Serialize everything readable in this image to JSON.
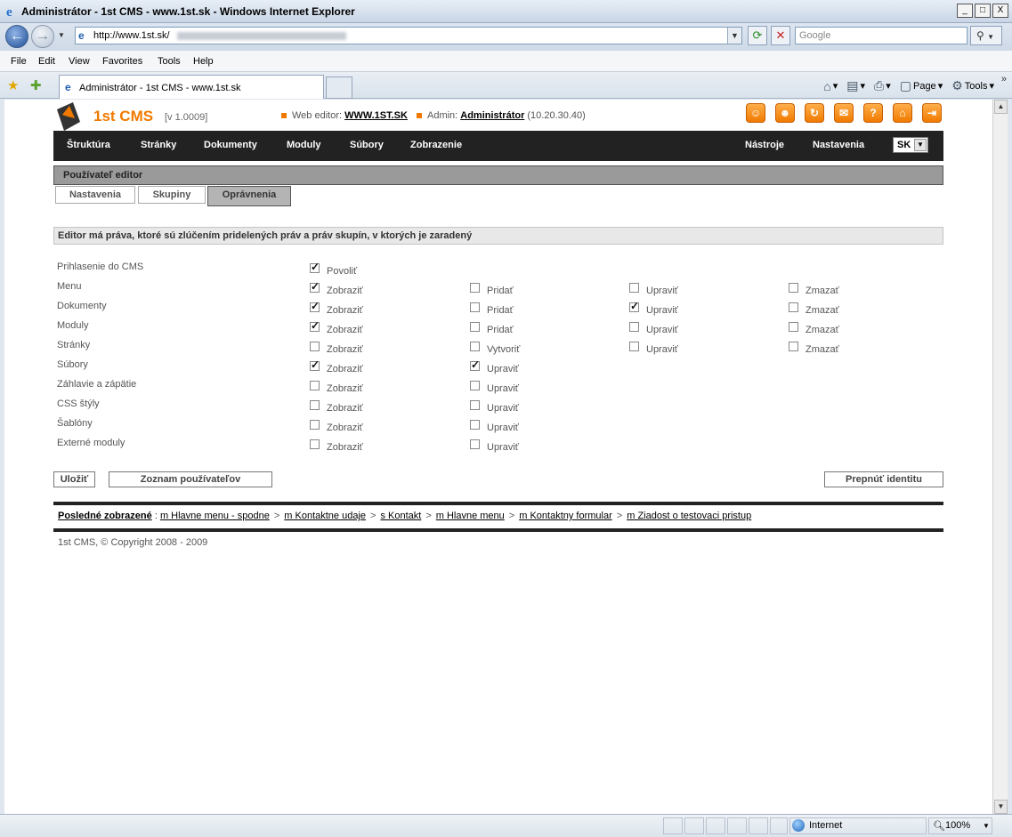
{
  "window": {
    "title": "Administrátor - 1st CMS - www.1st.sk - Windows Internet Explorer",
    "controls": [
      "_",
      "□",
      "X"
    ]
  },
  "browser": {
    "url": "http://www.1st.sk/",
    "search_placeholder": "Google",
    "menu": [
      "File",
      "Edit",
      "View",
      "Favorites",
      "Tools",
      "Help"
    ],
    "tab_title": "Administrátor - 1st CMS - www.1st.sk",
    "command_bar": {
      "page": "Page",
      "tools": "Tools"
    },
    "status": {
      "zone": "Internet",
      "zoom": "100%"
    }
  },
  "cms": {
    "name": "1st CMS",
    "version": "[v 1.0009]",
    "web_editor_label": "Web editor:",
    "web_editor_link": "WWW.1ST.SK",
    "admin_label": "Admin:",
    "admin_name": "Administrátor",
    "admin_ip": "(10.20.30.40)",
    "tool_icons": [
      "user-icon",
      "users-icon",
      "refresh-icon",
      "mail-icon",
      "help-icon",
      "home-icon",
      "logout-icon"
    ],
    "accent_color": "#f07a00"
  },
  "nav": {
    "left": [
      "Štruktúra",
      "Stránky",
      "Dokumenty",
      "Moduly",
      "Súbory",
      "Zobrazenie"
    ],
    "right": [
      "Nástroje",
      "Nastavenia"
    ],
    "language": "SK"
  },
  "section": {
    "title": "Používateľ editor",
    "tabs": [
      "Nastavenia",
      "Skupiny",
      "Oprávnenia"
    ],
    "active_tab": "Oprávnenia",
    "description": "Editor má práva, ktoré sú zlúčením pridelených práv a práv skupín, v ktorých je zaradený"
  },
  "permissions": [
    {
      "label": "Prihlasenie do CMS",
      "options": [
        {
          "label": "Povoliť",
          "checked": true
        }
      ]
    },
    {
      "label": "Menu",
      "options": [
        {
          "label": "Zobraziť",
          "checked": true
        },
        {
          "label": "Pridať",
          "checked": false
        },
        {
          "label": "Upraviť",
          "checked": false
        },
        {
          "label": "Zmazať",
          "checked": false
        }
      ]
    },
    {
      "label": "Dokumenty",
      "options": [
        {
          "label": "Zobraziť",
          "checked": true
        },
        {
          "label": "Pridať",
          "checked": false
        },
        {
          "label": "Upraviť",
          "checked": true
        },
        {
          "label": "Zmazať",
          "checked": false
        }
      ]
    },
    {
      "label": "Moduly",
      "options": [
        {
          "label": "Zobraziť",
          "checked": true
        },
        {
          "label": "Pridať",
          "checked": false
        },
        {
          "label": "Upraviť",
          "checked": false
        },
        {
          "label": "Zmazať",
          "checked": false
        }
      ]
    },
    {
      "label": "Stránky",
      "options": [
        {
          "label": "Zobraziť",
          "checked": false
        },
        {
          "label": "Vytvoriť",
          "checked": false
        },
        {
          "label": "Upraviť",
          "checked": false
        },
        {
          "label": "Zmazať",
          "checked": false
        }
      ]
    },
    {
      "label": "Súbory",
      "options": [
        {
          "label": "Zobraziť",
          "checked": true
        },
        {
          "label": "Upraviť",
          "checked": true
        }
      ]
    },
    {
      "label": "Záhlavie a zápätie",
      "options": [
        {
          "label": "Zobraziť",
          "checked": false
        },
        {
          "label": "Upraviť",
          "checked": false
        }
      ]
    },
    {
      "label": "CSS štýly",
      "options": [
        {
          "label": "Zobraziť",
          "checked": false
        },
        {
          "label": "Upraviť",
          "checked": false
        }
      ]
    },
    {
      "label": "Šablóny",
      "options": [
        {
          "label": "Zobraziť",
          "checked": false
        },
        {
          "label": "Upraviť",
          "checked": false
        }
      ]
    },
    {
      "label": "Externé moduly",
      "options": [
        {
          "label": "Zobraziť",
          "checked": false
        },
        {
          "label": "Upraviť",
          "checked": false
        }
      ]
    }
  ],
  "buttons": {
    "save": "Uložiť",
    "user_list": "Zoznam používateľov",
    "switch_identity": "Prepnúť identitu"
  },
  "recent": {
    "title": "Posledné zobrazené",
    "items": [
      "m Hlavne menu - spodne",
      "m Kontaktne udaje",
      "s Kontakt",
      "m Hlavne menu",
      "m Kontaktny formular",
      "m Ziadost o testovaci pristup"
    ]
  },
  "copyright": "1st CMS, © Copyright 2008 - 2009"
}
